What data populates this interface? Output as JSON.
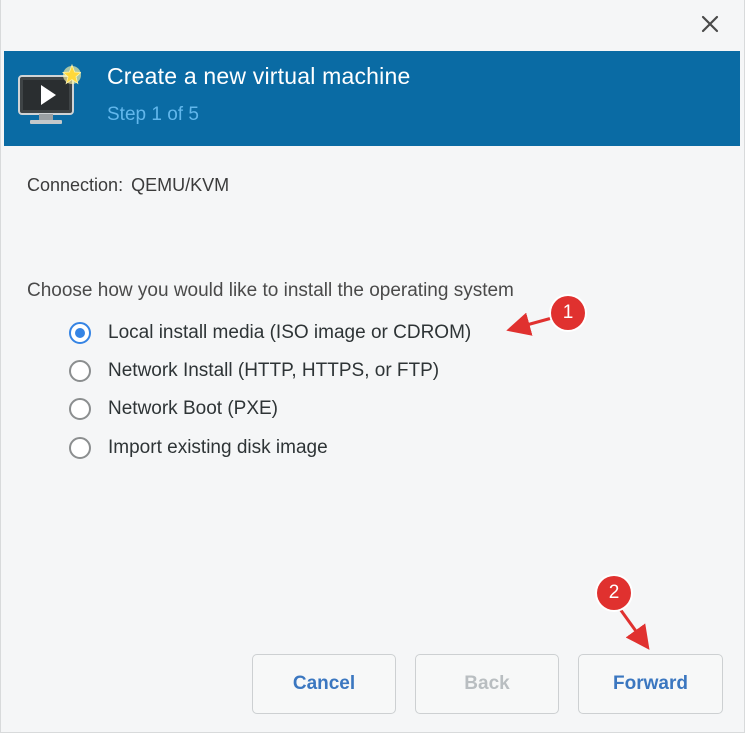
{
  "window": {
    "close_icon": "close-icon"
  },
  "header": {
    "title": "Create a new virtual machine",
    "step": "Step 1 of 5",
    "icon": "vm-monitor-icon",
    "background_color": "#0a6ba4"
  },
  "connection": {
    "label": "Connection:",
    "value": "QEMU/KVM"
  },
  "install": {
    "prompt": "Choose how you would like to install the operating system",
    "options": [
      {
        "label": "Local install media (ISO image or CDROM)",
        "selected": true
      },
      {
        "label": "Network Install (HTTP, HTTPS, or FTP)",
        "selected": false
      },
      {
        "label": "Network Boot (PXE)",
        "selected": false
      },
      {
        "label": "Import existing disk image",
        "selected": false
      }
    ]
  },
  "buttons": {
    "cancel": "Cancel",
    "back": "Back",
    "forward": "Forward"
  },
  "annotations": [
    {
      "number": "1"
    },
    {
      "number": "2"
    }
  ],
  "colors": {
    "accent": "#3584e4",
    "annotation": "#e0312f"
  }
}
